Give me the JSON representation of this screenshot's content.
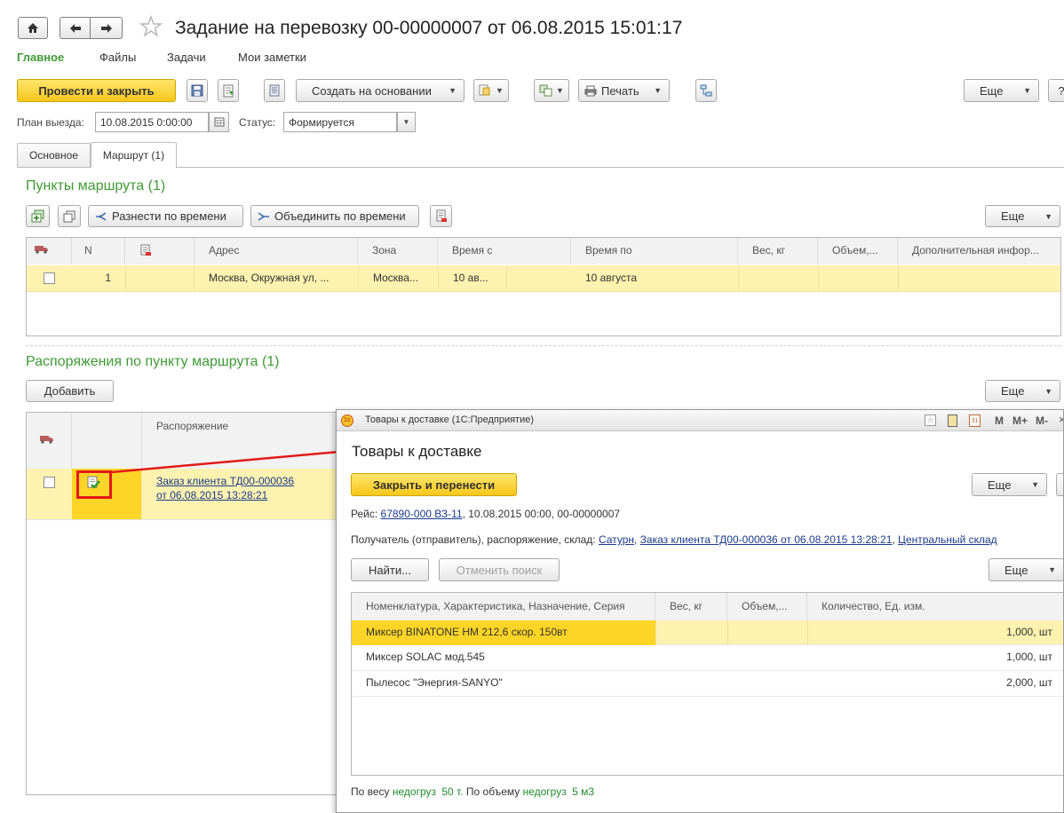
{
  "window": {
    "title": "Задание на перевозку 00-00000007 от 06.08.2015 15:01:17"
  },
  "menu": {
    "items": [
      "Главное",
      "Файлы",
      "Задачи",
      "Мои заметки"
    ]
  },
  "toolbar": {
    "post_close": "Провести и закрыть",
    "create_based": "Создать на основании",
    "print": "Печать",
    "more": "Еще",
    "help": "?"
  },
  "header_fields": {
    "plan_label": "План выезда:",
    "plan_value": "10.08.2015  0:00:00",
    "status_label": "Статус:",
    "status_value": "Формируется"
  },
  "tabs": [
    "Основное",
    "Маршрут (1)"
  ],
  "route_points": {
    "title": "Пункты маршрута (1)",
    "btn_spread": "Разнести по времени",
    "btn_merge": "Объединить по времени",
    "more": "Еще",
    "columns": [
      "N",
      "Адрес",
      "Зона",
      "Время с",
      "Время по",
      "Вес, кг",
      "Объем,...",
      "Дополнительная инфор..."
    ],
    "rows": [
      {
        "n": "1",
        "address": "Москва, Окружная ул, ...",
        "zone": "Москва...",
        "time_from": "10 ав...",
        "time_to": "10 августа",
        "weight": "",
        "volume": "",
        "info": ""
      }
    ]
  },
  "orders": {
    "title": "Распоряжения по пункту маршрута (1)",
    "add": "Добавить",
    "more": "Еще",
    "column": "Распоряжение",
    "rows": [
      {
        "line1": "Заказ клиента ТД00-000036",
        "line2": "от 06.08.2015 13:28:21"
      }
    ]
  },
  "popup": {
    "window_title": "Товары к доставке  (1С:Предприятие)",
    "title_controls": [
      "M",
      "M+",
      "M-"
    ],
    "heading": "Товары к доставке",
    "close_transfer": "Закрыть и перенести",
    "more": "Еще",
    "trip_label": "Рейс:",
    "trip_link": "67890-000 ВЗ-11",
    "trip_rest": ", 10.08.2015 00:00, 00-00000007",
    "recipient_label": "Получатель (отправитель), распоряжение, склад:",
    "recipient_link1": "Сатурн",
    "recipient_link2": "Заказ клиента ТД00-000036 от 06.08.2015 13:28:21",
    "recipient_link3": "Центральный склад",
    "find": "Найти...",
    "cancel_search": "Отменить поиск",
    "columns": [
      "Номенклатура, Характеристика, Назначение, Серия",
      "Вес, кг",
      "Объем,...",
      "Количество, Ед. изм."
    ],
    "rows": [
      {
        "name": "Миксер BINATONE HM 212,6 скор. 150вт",
        "weight": "",
        "volume": "",
        "qty": "1,000, шт"
      },
      {
        "name": "Миксер SOLAC мод.545",
        "weight": "",
        "volume": "",
        "qty": "1,000, шт"
      },
      {
        "name": "Пылесос \"Энергия-SANYO\"",
        "weight": "",
        "volume": "",
        "qty": "2,000, шт"
      }
    ],
    "footer": {
      "by_weight": "По весу",
      "weight_status": "недогруз",
      "weight_value": "50 т.",
      "by_volume": "По объему",
      "volume_status": "недогруз",
      "volume_value": "5 м3"
    }
  },
  "colors": {
    "accent_green": "#3f9a35",
    "selected_row": "#fdf2b0",
    "selected_cell": "#fcd526",
    "link": "#1c3a8c",
    "annotation_red": "#e21a1a"
  }
}
